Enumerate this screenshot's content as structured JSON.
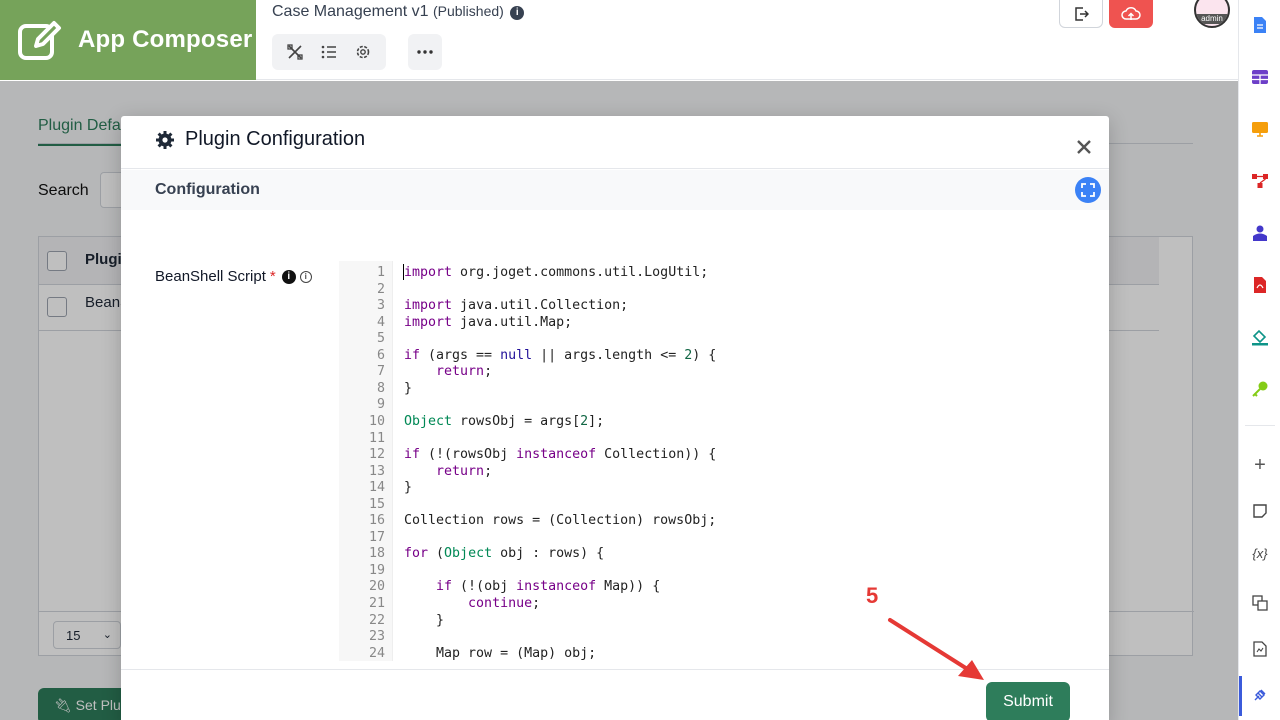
{
  "brand": {
    "name": "App Composer"
  },
  "header": {
    "app_name": "Case Management v1",
    "status": "(Published)"
  },
  "background": {
    "tab_label": "Plugin Defa",
    "search_label": "Search",
    "column_header": "Plugi",
    "row_value": "BeanS",
    "page_size": "15",
    "set_plugin_label": "Set Plug"
  },
  "modal": {
    "title": "Plugin Configuration",
    "section": "Configuration",
    "field_label": "BeanShell Script",
    "required_mark": "*",
    "submit_label": "Submit"
  },
  "editor": {
    "lines": [
      "import org.joget.commons.util.LogUtil;",
      "",
      "import java.util.Collection;",
      "import java.util.Map;",
      "",
      "if (args == null || args.length <= 2) {",
      "    return;",
      "}",
      "",
      "Object rowsObj = args[2];",
      "",
      "if (!(rowsObj instanceof Collection)) {",
      "    return;",
      "}",
      "",
      "Collection rows = (Collection) rowsObj;",
      "",
      "for (Object obj : rows) {",
      "",
      "    if (!(obj instanceof Map)) {",
      "        continue;",
      "    }",
      "",
      "    Map row = (Map) obj;"
    ]
  },
  "annotation": {
    "step": "5"
  },
  "right_rail": {
    "icons": [
      "document-icon",
      "table-icon",
      "monitor-icon",
      "flow-icon",
      "user-group-icon",
      "pdf-icon",
      "paint-bucket-icon",
      "key-icon",
      "plus-icon",
      "note-icon",
      "variable-icon",
      "translate-icon",
      "file-icon",
      "plugin-icon"
    ]
  },
  "colors": {
    "brand": "#76a35a",
    "primary": "#2e7d5b",
    "danger": "#ef5350",
    "accent": "#3b82f6",
    "annotation": "#e53935"
  }
}
